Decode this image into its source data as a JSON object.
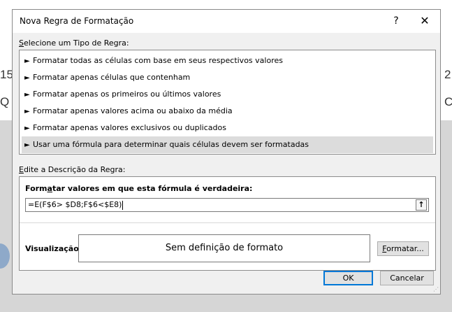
{
  "background": {
    "left_text_1": "15",
    "left_text_2": "Q",
    "right_text_1": "2",
    "right_text_2": "C"
  },
  "dialog": {
    "title": "Nova Regra de Formatação",
    "help_label": "?",
    "close_label": "✕",
    "select_type_label_mnemonic": "S",
    "select_type_label_rest": "elecione um Tipo de Regra:",
    "rule_types": [
      {
        "label": "Formatar todas as células com base em seus respectivos valores",
        "selected": false
      },
      {
        "label": "Formatar apenas células que contenham",
        "selected": false
      },
      {
        "label": "Formatar apenas os primeiros ou últimos valores",
        "selected": false
      },
      {
        "label": "Formatar apenas valores acima ou abaixo da média",
        "selected": false
      },
      {
        "label": "Formatar apenas valores exclusivos ou duplicados",
        "selected": false
      },
      {
        "label": "Usar uma fórmula para determinar quais células devem ser formatadas",
        "selected": true
      }
    ],
    "edit_desc_label_mnemonic": "E",
    "edit_desc_label_rest": "dite a Descrição da Regra:",
    "formula_label_pre": "Form",
    "formula_label_mnemonic": "a",
    "formula_label_post": "tar valores em que esta fórmula é verdadeira:",
    "formula_value": "=E(F$6> $D8;F$6<$E8)",
    "collapse_icon": "↑",
    "preview_label": "Visualização:",
    "preview_text": "Sem definição de formato",
    "format_button_pre": "",
    "format_button_mnemonic": "F",
    "format_button_post": "ormatar...",
    "ok_label": "OK",
    "cancel_label": "Cancelar"
  }
}
